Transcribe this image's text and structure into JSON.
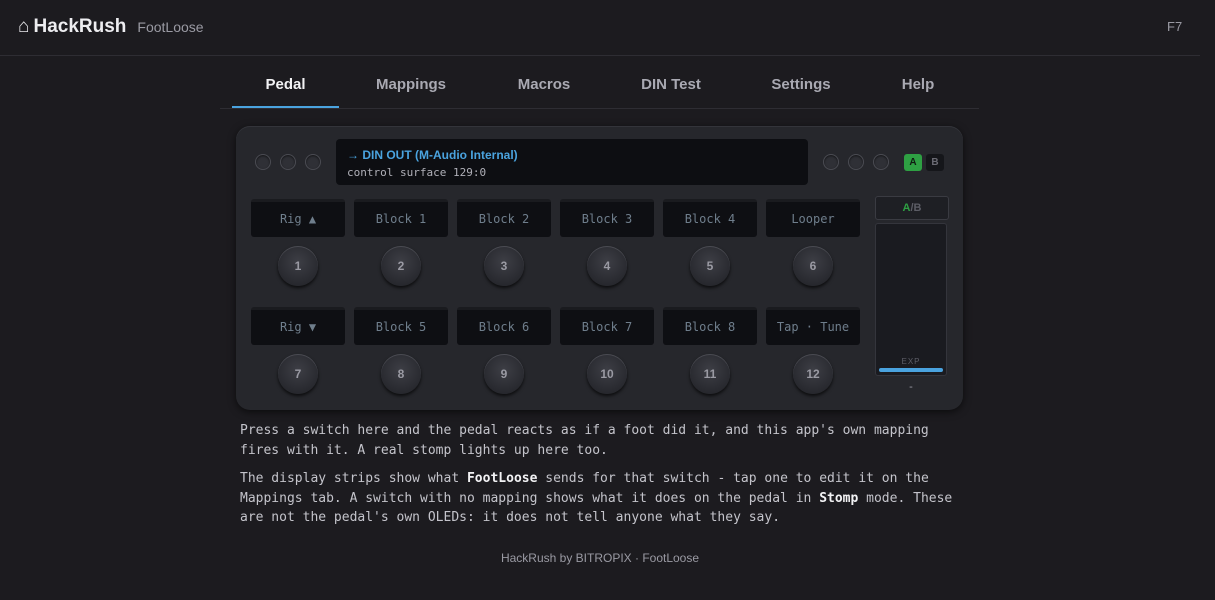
{
  "header": {
    "home_icon": "⌂",
    "title": "HackRush",
    "subtitle": "FootLoose",
    "hotkey": "F7"
  },
  "tabs": [
    {
      "label": "Pedal",
      "active": true
    },
    {
      "label": "Mappings",
      "active": false
    },
    {
      "label": "Macros",
      "active": false
    },
    {
      "label": "DIN Test",
      "active": false
    },
    {
      "label": "Settings",
      "active": false
    },
    {
      "label": "Help",
      "active": false
    }
  ],
  "pedal": {
    "display": {
      "line1": "→ DIN OUT (M-Audio Internal)",
      "line2": "control surface 129:0"
    },
    "ab_buttons": {
      "a": "A",
      "b": "B",
      "active": "A"
    },
    "rows": [
      {
        "strips": [
          "Rig ▲",
          "Block 1",
          "Block 2",
          "Block 3",
          "Block 4",
          "Looper"
        ],
        "switches": [
          "1",
          "2",
          "3",
          "4",
          "5",
          "6"
        ]
      },
      {
        "strips": [
          "Rig ▼",
          "Block 5",
          "Block 6",
          "Block 7",
          "Block 8",
          "Tap · Tune"
        ],
        "switches": [
          "7",
          "8",
          "9",
          "10",
          "11",
          "12"
        ]
      }
    ],
    "ab_toggle": {
      "a": "A",
      "rest": "/B"
    },
    "expression": {
      "label": "EXP",
      "value": "-",
      "level": 1.0
    },
    "colors": {
      "accent": "#4aa3df",
      "active_green": "#2ea043"
    }
  },
  "description": {
    "p1": "Press a switch here and the pedal reacts as if a foot did it, and this app's own mapping fires with it. A real stomp lights up here too.",
    "p2_a": "The display strips show what ",
    "p2_b": "FootLoose",
    "p2_c": " sends for that switch - tap one to edit it on the Mappings tab. A switch with no mapping shows what it does on the pedal in ",
    "p2_d": "Stomp",
    "p2_e": " mode. These are not the pedal's own OLEDs: it does not tell anyone what they say."
  },
  "footer": "HackRush by BITROPIX · FootLoose"
}
